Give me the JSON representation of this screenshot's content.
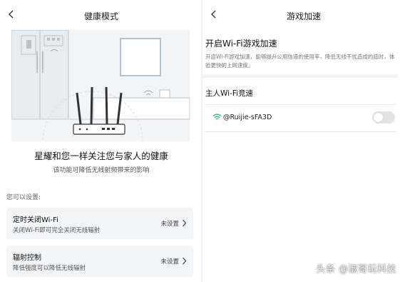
{
  "left": {
    "title": "健康模式",
    "hero_title": "星耀和您一样关注您与家人的健康",
    "hero_sub": "该功能可降低无线射频带来的影响",
    "section_label": "您可以设置:",
    "cards": [
      {
        "title": "定时关闭Wi-Fi",
        "desc": "关闭Wi-Fi即可完全关闭无线辐射",
        "status": "未设置"
      },
      {
        "title": "辐射控制",
        "desc": "降低强度可以降低无线辐射",
        "status": "未设置"
      }
    ]
  },
  "right": {
    "title": "游戏加速",
    "heading": "开启Wi-Fi游戏加速",
    "description": "开启Wi-Fi游戏加速，能够提升公用信道的使用率，降低无线干扰造成的延时，体验更快的上网速度。",
    "section": "主人Wi-Fi竞速",
    "ssid": "@Ruijie-sFA3D",
    "toggle_on": false
  },
  "watermark": "头条 @淑哥玩科技",
  "icons": {
    "back": "chevron-left-icon",
    "wifi": "wifi-icon",
    "chevron": "chevron-right-icon"
  },
  "colors": {
    "wifi_icon": "#2bb673",
    "card_bg": "#f4f5f7",
    "toggle_off": "#e3e3e3"
  }
}
